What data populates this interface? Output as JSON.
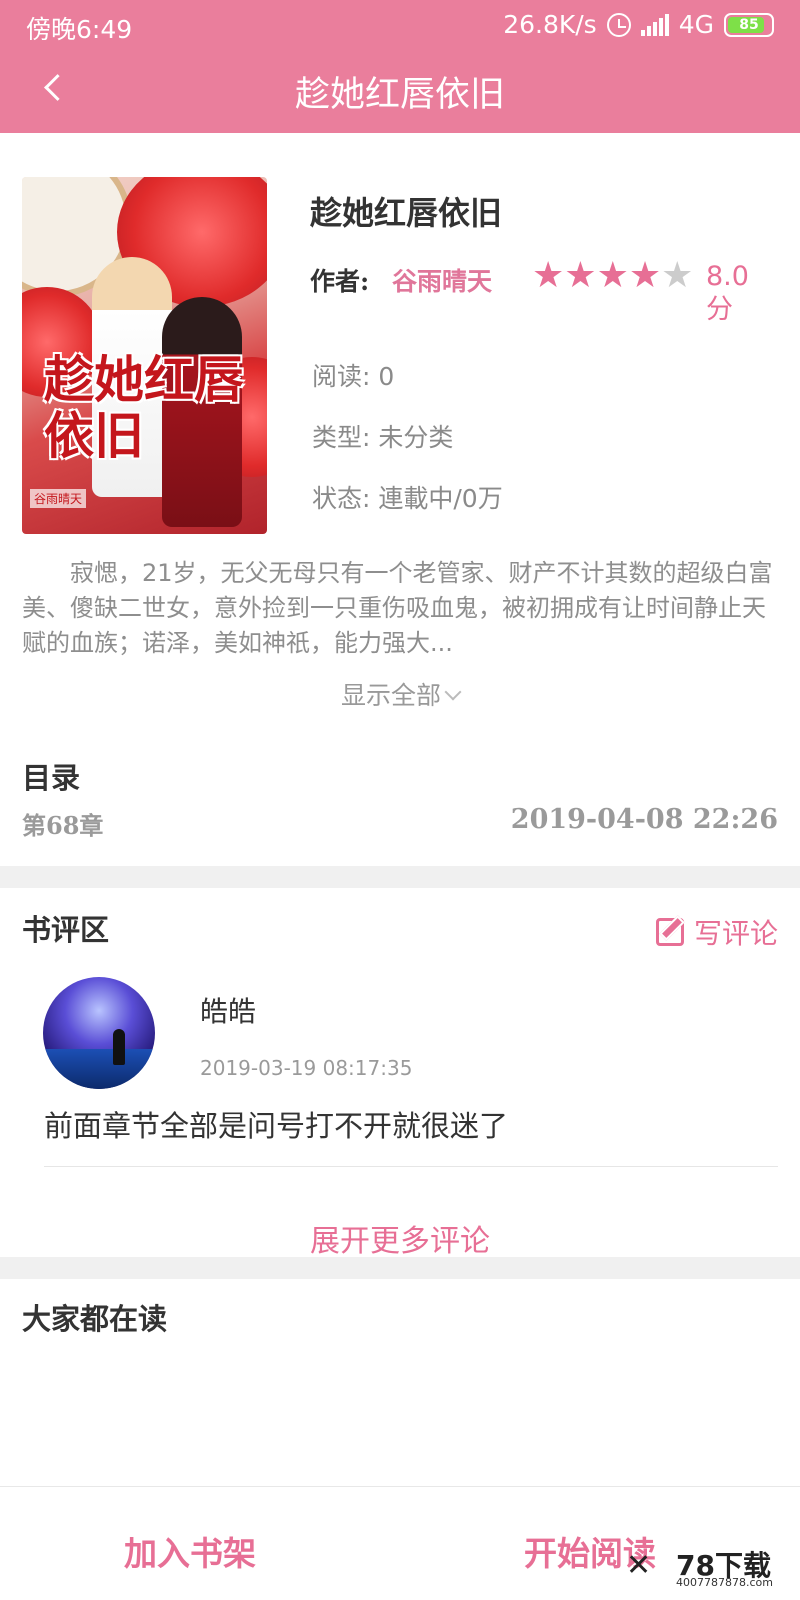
{
  "status_bar": {
    "time": "傍晚6:49",
    "network_speed": "26.8K/s",
    "network_type": "4G",
    "battery": "85"
  },
  "nav": {
    "title": "趁她红唇依旧",
    "back_icon": "chevron-left-icon"
  },
  "book": {
    "cover_title": "趁她红唇依旧",
    "cover_author": "谷雨晴天",
    "title": "趁她红唇依旧",
    "author_label": "作者:",
    "author": "谷雨晴天",
    "rating_stars": 4,
    "rating_max": 5,
    "score": "8.0分",
    "reads": "阅读: 0",
    "category": "类型: 未分类",
    "status": "状态: 連載中/0万",
    "description": "寂愢，21岁，无父无母只有一个老管家、财产不计其数的超级白富美、傻缺二世女，意外捡到一只重伤吸血鬼，被初拥成有让时间静止天赋的血族；诺泽，美如神祇，能力强大...",
    "show_all": "显示全部"
  },
  "directory": {
    "title": "目录",
    "latest_chapter": "第68章",
    "updated": "2019-04-08  22:26"
  },
  "comments": {
    "title": "书评区",
    "write_label": "写评论",
    "items": [
      {
        "user": "皓皓",
        "time": "2019-03-19 08:17:35",
        "text": "前面章节全部是问号打不开就很迷了"
      }
    ],
    "more_label": "展开更多评论"
  },
  "recommend": {
    "title": "大家都在读"
  },
  "bottom_bar": {
    "add_shelf": "加入书架",
    "start_reading": "开始阅读"
  },
  "watermark": {
    "brand": "78下载",
    "url": "4007787878.com"
  },
  "colors": {
    "header": "#ea7e9c",
    "accent": "#e76f95",
    "star_off": "#cccccc"
  }
}
